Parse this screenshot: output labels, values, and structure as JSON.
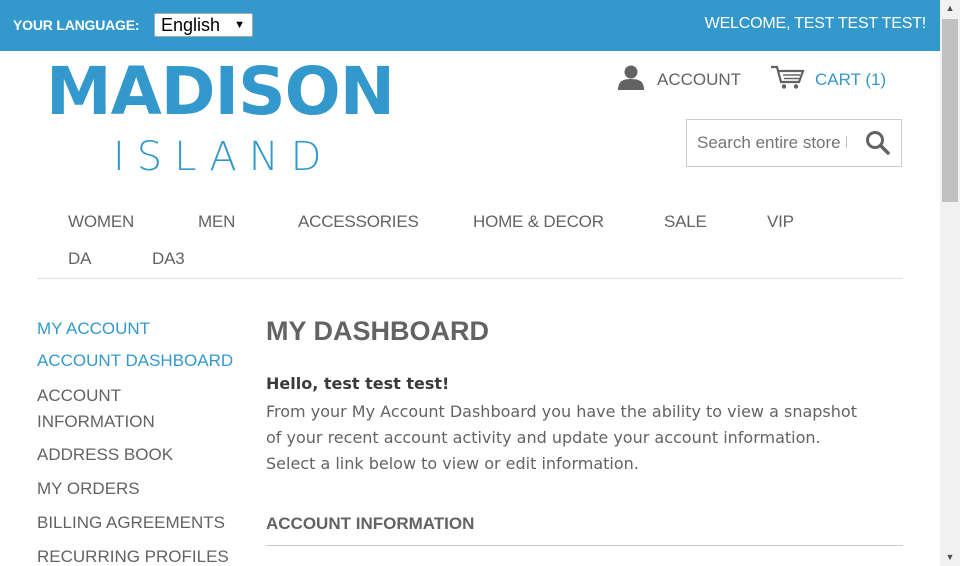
{
  "topbar": {
    "language_label": "YOUR LANGUAGE:",
    "language_value": "English",
    "welcome": "WELCOME, TEST TEST TEST!"
  },
  "logo": {
    "main": "MADISON",
    "sub": "ISLAND"
  },
  "header": {
    "account_label": "ACCOUNT",
    "cart_label": "CART (1)",
    "search_placeholder": "Search entire store here..."
  },
  "nav": {
    "items": [
      "WOMEN",
      "MEN",
      "ACCESSORIES",
      "HOME & DECOR",
      "SALE",
      "VIP",
      "DA",
      "DA3"
    ]
  },
  "sidebar": {
    "title": "MY ACCOUNT",
    "items": [
      {
        "label": "ACCOUNT DASHBOARD",
        "active": true
      },
      {
        "label": "ACCOUNT INFORMATION",
        "active": false
      },
      {
        "label": "ADDRESS BOOK",
        "active": false
      },
      {
        "label": "MY ORDERS",
        "active": false
      },
      {
        "label": "BILLING AGREEMENTS",
        "active": false
      },
      {
        "label": "RECURRING PROFILES",
        "active": false
      }
    ]
  },
  "main": {
    "title": "MY DASHBOARD",
    "hello": "Hello, test test test!",
    "intro": "From your My Account Dashboard you have the ability to view a snapshot of your recent account activity and update your account information. Select a link below to view or edit information.",
    "section_title": "ACCOUNT INFORMATION"
  },
  "colors": {
    "brand": "#3399cc",
    "text": "#636363"
  }
}
